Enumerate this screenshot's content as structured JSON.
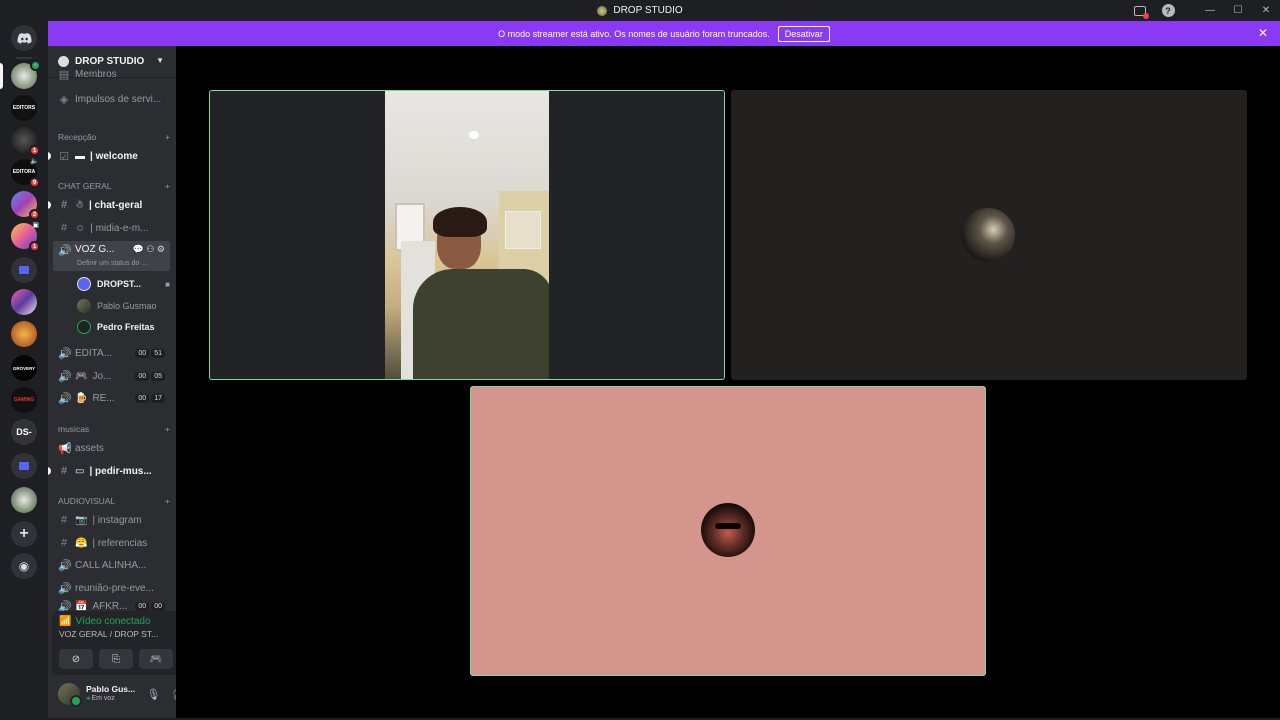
{
  "window": {
    "title": "DROP STUDIO",
    "controls": [
      "minimize",
      "maximize",
      "close"
    ]
  },
  "banner": {
    "text": "O modo streamer está ativo. Os nomes de usuário foram truncados.",
    "button_label": "Desativar"
  },
  "guilds": [
    {
      "name": "home-discord",
      "label": ""
    },
    {
      "name": "server-1",
      "label": ""
    },
    {
      "name": "editors-server",
      "label": "EDITORS"
    },
    {
      "name": "server-3",
      "badge": "1"
    },
    {
      "name": "editora-server",
      "label": "EDITORA",
      "badge": "9"
    },
    {
      "name": "server-5",
      "badge": "2"
    },
    {
      "name": "server-6",
      "badge": "1"
    },
    {
      "name": "folder-1",
      "label": ""
    },
    {
      "name": "server-8",
      "label": ""
    },
    {
      "name": "server-9",
      "label": ""
    },
    {
      "name": "grovery-server",
      "label": "GROVERY"
    },
    {
      "name": "gaming-server",
      "label": "GAMING"
    },
    {
      "name": "ds-server",
      "label": "DS-"
    },
    {
      "name": "folder-2",
      "label": ""
    },
    {
      "name": "server-14",
      "label": ""
    },
    {
      "name": "add-server",
      "label": "+"
    },
    {
      "name": "discover",
      "label": ""
    }
  ],
  "server": {
    "name": "DROP STUDIO",
    "channels_top": [
      {
        "label": "Membros"
      },
      {
        "label": "Impulsos de servi..."
      }
    ],
    "categories": {
      "recepcao": "Recepção",
      "chat_geral": "CHAT GERAL",
      "musicas": "musicas",
      "audiovisual": "AUDIOVISUAL"
    },
    "channels": {
      "welcome": "| welcome",
      "chat_geral": "| chat-geral",
      "midia": "| midia-e-m...",
      "voz_geral": "VOZ G...",
      "voz_status": "Definir um status do ...",
      "editar": "EDITA...",
      "jogos": "Jo...",
      "re": "RE...",
      "assets": "assets",
      "pedir_mus": "| pedir-mus...",
      "instagram": "| instagram",
      "referencias": "| referencias",
      "call": "CALL ALINHA...",
      "reuniao": "reunião-pre-eve...",
      "afkr": "AFKR..."
    },
    "counts": {
      "editar": [
        "00",
        "51"
      ],
      "jogos": [
        "00",
        "05"
      ],
      "re": [
        "00",
        "17"
      ],
      "afkr": [
        "00",
        "00"
      ]
    },
    "voice_users": [
      {
        "name": "DROPST..."
      },
      {
        "name": "Pablo Gusmao"
      },
      {
        "name": "Pedro Freitas"
      }
    ]
  },
  "voice_panel": {
    "status": "Vídeo conectado",
    "location": "VOZ GERAL / DROP ST..."
  },
  "user_panel": {
    "username": "Pablo Gus...",
    "status": "Em voz"
  },
  "colors": {
    "banner": "#8a39f5",
    "speaking_border": "#7fd99a",
    "connected": "#23a55a",
    "tile3_bg": "#d4968c"
  }
}
